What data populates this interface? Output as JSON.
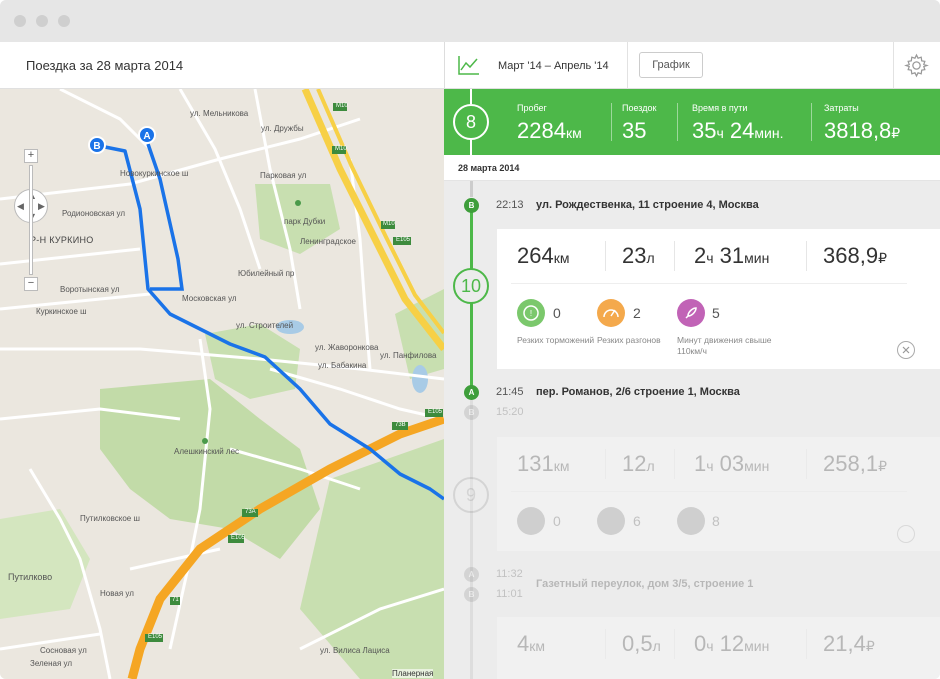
{
  "window_title_dots": [
    "close",
    "minimize",
    "maximize"
  ],
  "left_header": {
    "title": "Поездка за 28 марта 2014"
  },
  "map": {
    "labels": {
      "district": "Р-Н КУРКИНО",
      "park_dubki": "парк Дубки",
      "forest": "Алешкинский лес",
      "putilkovo": "Путилково",
      "planernaya": "Планерная",
      "street_druzhby": "ул. Дружбы",
      "street_rodionovskaya": "Родионовская ул",
      "street_vorotynskaya": "Воротынская ул",
      "street_kurkinskoe": "Куркинское ш",
      "street_novokurkinskoe": "Новокуркинское ш",
      "street_yubileyny": "Юбилейный пр",
      "street_paltsevskaya": "ул. Панфилова",
      "street_babakina": "ул. Бабакина",
      "street_stroitelei": "ул. Строителей",
      "street_leningr": "Ленинградское",
      "street_vilisa": "ул. Вилиса Лациса",
      "street_putilkovskoe": "Путилковское ш",
      "street_moskovskaya": "Московская ул",
      "street_zhuravleva": "ул. Жаворонкова",
      "street_melnikova": "ул. Мельникова",
      "street_parkovaya": "Парковая ул",
      "street_sosnovaya": "Сосновая ул",
      "street_zelenaya": "Зеленая ул",
      "street_novaya": "Новая ул",
      "road_m10": "М10",
      "road_e105": "E105",
      "road_73b": "73В",
      "road_73a": "73А",
      "road_71": "71"
    },
    "pins": {
      "start": "A",
      "end": "B"
    },
    "controls": {
      "zoom_in": "+",
      "zoom_out": "−"
    },
    "route_color": "#1a73e8",
    "highway_color": "#f5a623"
  },
  "right_header": {
    "period": "Март '14 – Апрель '14",
    "graph_button": "График"
  },
  "summary": {
    "trips_count": "8",
    "mileage": {
      "label": "Пробег",
      "value": "2284",
      "unit": "км"
    },
    "trips": {
      "label": "Поездок",
      "value": "35"
    },
    "time": {
      "label": "Время в пути",
      "hours": "35",
      "h_unit": "ч",
      "minutes": "24",
      "m_unit": "мин."
    },
    "cost": {
      "label": "Затраты",
      "value": "3818,8",
      "unit": "₽"
    },
    "accent": "#4db849"
  },
  "date_label": "28 марта 2014",
  "trips": [
    {
      "number": "10",
      "end": {
        "point": "B",
        "time": "22:13",
        "address": "ул. Рождественка, 11 строение 4, Москва"
      },
      "start": {
        "point": "A",
        "time": "21:45",
        "address": "пер. Романов, 2/6 строение 1, Москва"
      },
      "distance": "264",
      "distance_unit": "км",
      "fuel": "23",
      "fuel_unit": "л",
      "dur_h": "2",
      "dur_h_unit": "ч",
      "dur_m": "31",
      "dur_m_unit": "мин",
      "cost": "368,9",
      "cost_unit": "₽",
      "braking": {
        "count": "0",
        "label": "Резких торможений"
      },
      "accel": {
        "count": "2",
        "label": "Резких разгонов"
      },
      "speeding": {
        "count": "5",
        "label": "Минут движения свыше 110км/ч"
      }
    },
    {
      "number": "9",
      "end_time": "15:20",
      "distance": "131",
      "distance_unit": "км",
      "fuel": "12",
      "fuel_unit": "л",
      "dur_h": "1",
      "dur_h_unit": "ч",
      "dur_m": "03",
      "dur_m_unit": "мин",
      "cost": "258,1",
      "cost_unit": "₽",
      "braking": {
        "count": "0"
      },
      "accel": {
        "count": "6"
      },
      "speeding": {
        "count": "8"
      }
    },
    {
      "start_time": "11:32",
      "address": "Газетный переулок, дом 3/5, строение 1",
      "end_time": "11:01",
      "distance": "4",
      "distance_unit": "км",
      "fuel": "0,5",
      "fuel_unit": "л",
      "dur_h": "0",
      "dur_h_unit": "ч",
      "dur_m": "12",
      "dur_m_unit": "мин",
      "cost": "21,4",
      "cost_unit": "₽"
    }
  ]
}
